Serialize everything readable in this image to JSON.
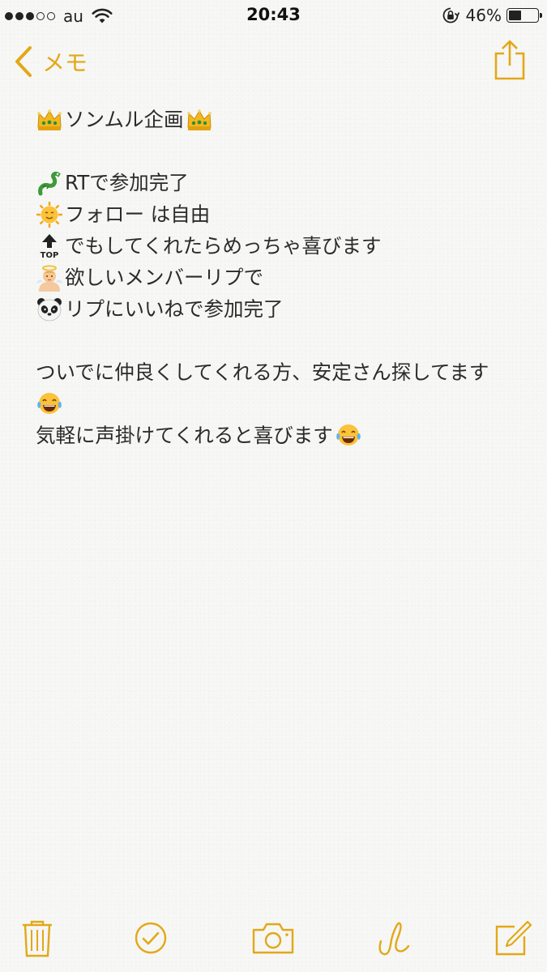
{
  "status_bar": {
    "signal_full": 3,
    "signal_total": 5,
    "carrier": "au",
    "time": "20:43",
    "battery_percent_label": "46%",
    "battery_level": 0.46
  },
  "nav": {
    "back_label": "メモ",
    "back_icon": "chevron-left-icon",
    "share_icon": "share-icon",
    "accent_color": "#e2a817"
  },
  "note": {
    "title": "ソンムル企画",
    "items": [
      {
        "icon": "dragon-emoji",
        "text": "RTで参加完了"
      },
      {
        "icon": "sun-face-emoji",
        "text": "フォロー は自由"
      },
      {
        "icon": "top-arrow-emoji",
        "text": "でもしてくれたらめっちゃ喜びます"
      },
      {
        "icon": "baby-angel-emoji",
        "text": "欲しいメンバーリプで"
      },
      {
        "icon": "panda-emoji",
        "text": "リプにいいねで参加完了"
      }
    ],
    "closing_line1": "ついでに仲良くしてくれる方、安定さん探してます",
    "closing_line3": "気軽に声掛けてくれると喜びます"
  },
  "toolbar": {
    "icons": [
      "trash-icon",
      "checklist-icon",
      "camera-icon",
      "sketch-icon",
      "compose-icon"
    ]
  }
}
